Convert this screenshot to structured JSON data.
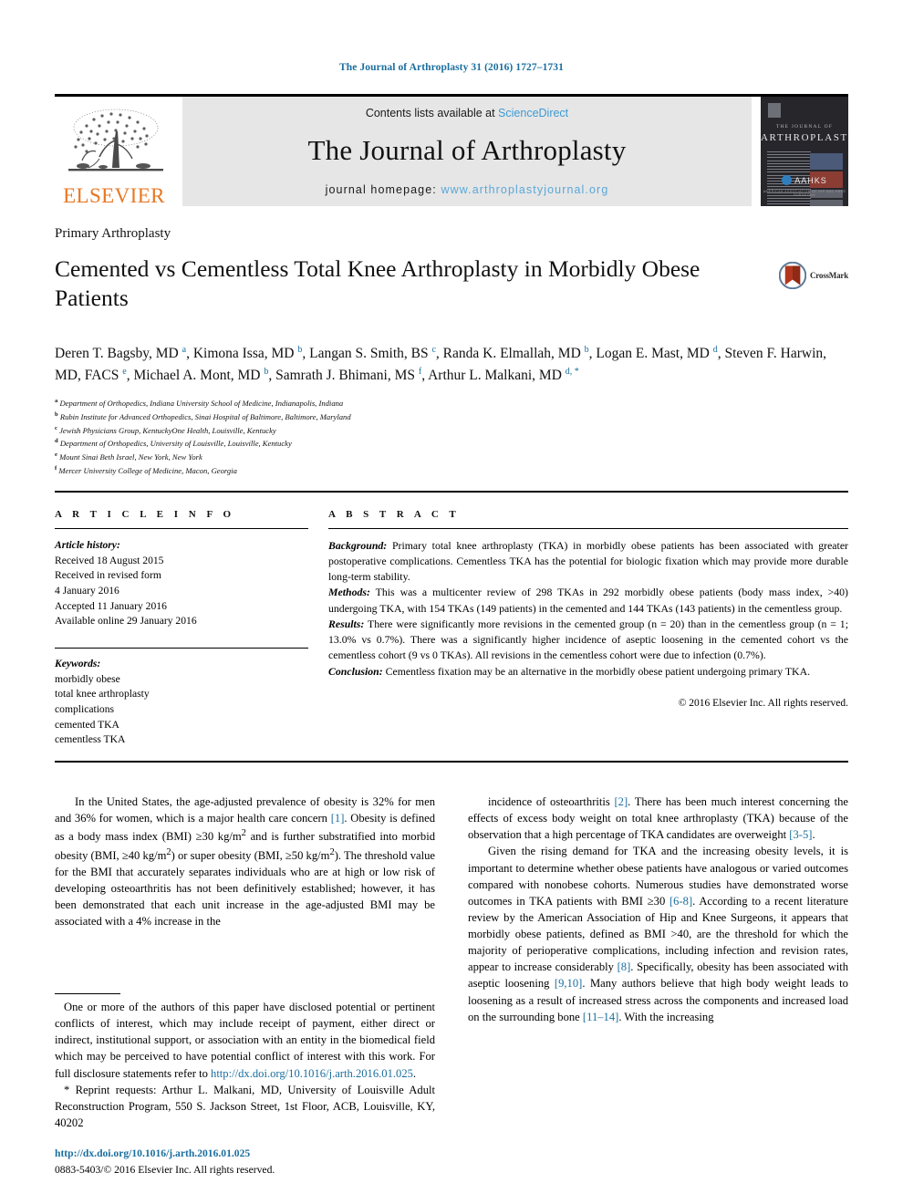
{
  "running_head": "The Journal of Arthroplasty 31 (2016) 1727–1731",
  "masthead": {
    "publisher": "ELSEVIER",
    "contents_prefix": "Contents lists available at ",
    "contents_link": "ScienceDirect",
    "journal_title": "The Journal of Arthroplasty",
    "homepage_prefix": "journal homepage: ",
    "homepage_url": "www.arthroplastyjournal.org",
    "cover": {
      "kicker": "THE JOURNAL OF",
      "name": "ARTHROPLASTY",
      "society": "AAHKS",
      "society_sub": "AMERICAN ASSOCIATION OF HIP AND KNEE SURGEONS"
    }
  },
  "article": {
    "section_kicker": "Primary Arthroplasty",
    "title": "Cemented vs Cementless Total Knee Arthroplasty in Morbidly Obese Patients",
    "crossmark_label": "CrossMark",
    "authors_html": "Deren T. Bagsby, MD <sup>a</sup>, Kimona Issa, MD <sup>b</sup>, Langan S. Smith, BS <sup>c</sup>, Randa K. Elmallah, MD <sup>b</sup>, Logan E. Mast, MD <sup>d</sup>, Steven F. Harwin, MD, FACS <sup>e</sup>, Michael A. Mont, MD <sup>b</sup>, Samrath J. Bhimani, MS <sup>f</sup>, Arthur L. Malkani, MD <sup>d, *</sup>",
    "affiliations": [
      {
        "marker": "a",
        "text": "Department of Orthopedics, Indiana University School of Medicine, Indianapolis, Indiana"
      },
      {
        "marker": "b",
        "text": "Rubin Institute for Advanced Orthopedics, Sinai Hospital of Baltimore, Baltimore, Maryland"
      },
      {
        "marker": "c",
        "text": "Jewish Physicians Group, KentuckyOne Health, Louisville, Kentucky"
      },
      {
        "marker": "d",
        "text": "Department of Orthopedics, University of Louisville, Louisville, Kentucky"
      },
      {
        "marker": "e",
        "text": "Mount Sinai Beth Israel, New York, New York"
      },
      {
        "marker": "f",
        "text": "Mercer University College of Medicine, Macon, Georgia"
      }
    ]
  },
  "article_info": {
    "heading": "A R T I C L E  I N F O",
    "history_label": "Article history:",
    "history_lines": [
      "Received 18 August 2015",
      "Received in revised form",
      "4 January 2016",
      "Accepted 11 January 2016",
      "Available online 29 January 2016"
    ],
    "keywords_label": "Keywords:",
    "keywords": [
      "morbidly obese",
      "total knee arthroplasty",
      "complications",
      "cemented TKA",
      "cementless TKA"
    ]
  },
  "abstract": {
    "heading": "A B S T R A C T",
    "sections": [
      {
        "label": "Background:",
        "text": " Primary total knee arthroplasty (TKA) in morbidly obese patients has been associated with greater postoperative complications. Cementless TKA has the potential for biologic fixation which may provide more durable long-term stability."
      },
      {
        "label": "Methods:",
        "text": " This was a multicenter review of 298 TKAs in 292 morbidly obese patients (body mass index, >40) undergoing TKA, with 154 TKAs (149 patients) in the cemented and 144 TKAs (143 patients) in the cementless group."
      },
      {
        "label": "Results:",
        "text": " There were significantly more revisions in the cemented group (n = 20) than in the cementless group (n = 1; 13.0% vs 0.7%). There was a significantly higher incidence of aseptic loosening in the cemented cohort vs the cementless cohort (9 vs 0 TKAs). All revisions in the cementless cohort were due to infection (0.7%)."
      },
      {
        "label": "Conclusion:",
        "text": " Cementless fixation may be an alternative in the morbidly obese patient undergoing primary TKA."
      }
    ],
    "copyright": "© 2016 Elsevier Inc. All rights reserved."
  },
  "body": {
    "left_paragraph_html": "In the United States, the age-adjusted prevalence of obesity is 32% for men and 36% for women, which is a major health care concern <span class=\"ref\">[1]</span>. Obesity is defined as a body mass index (BMI) ≥30 kg/m<sup>2</sup> and is further substratified into morbid obesity (BMI, ≥40 kg/m<sup>2</sup>) or super obesity (BMI, ≥50 kg/m<sup>2</sup>). The threshold value for the BMI that accurately separates individuals who are at high or low risk of developing osteoarthritis has not been definitively established; however, it has been demonstrated that each unit increase in the age-adjusted BMI may be associated with a 4% increase in the",
    "right_paragraph_1_html": "incidence of osteoarthritis <span class=\"ref\">[2]</span>. There has been much interest concerning the effects of excess body weight on total knee arthroplasty (TKA) because of the observation that a high percentage of TKA candidates are overweight <span class=\"ref\">[3-5]</span>.",
    "right_paragraph_2_html": "Given the rising demand for TKA and the increasing obesity levels, it is important to determine whether obese patients have analogous or varied outcomes compared with nonobese cohorts. Numerous studies have demonstrated worse outcomes in TKA patients with BMI ≥30 <span class=\"ref\">[6-8]</span>. According to a recent literature review by the American Association of Hip and Knee Surgeons, it appears that morbidly obese patients, defined as BMI >40, are the threshold for which the majority of perioperative complications, including infection and revision rates, appear to increase considerably <span class=\"ref\">[8]</span>. Specifically, obesity has been associated with aseptic loosening <span class=\"ref\">[9,10]</span>. Many authors believe that high body weight leads to loosening as a result of increased stress across the components and increased load on the surrounding bone <span class=\"ref\">[11–14]</span>. With the increasing"
  },
  "footnotes": {
    "conflict_html": "One or more of the authors of this paper have disclosed potential or pertinent conflicts of interest, which may include receipt of payment, either direct or indirect, institutional support, or association with an entity in the biomedical field which may be perceived to have potential conflict of interest with this work. For full disclosure statements refer to <a class=\"doi-link\" href=\"#\">http://dx.doi.org/10.1016/j.arth.2016.01.025</a>.",
    "reprint_html": "<span class=\"star\">*</span> Reprint requests: Arthur L. Malkani, MD, University of Louisville Adult Reconstruction Program, 550 S. Jackson Street, 1st Floor, ACB, Louisville, KY, 40202",
    "doi": "http://dx.doi.org/10.1016/j.arth.2016.01.025",
    "issn": "0883-5403/© 2016 Elsevier Inc. All rights reserved."
  },
  "colors": {
    "link_blue": "#1a6e9e",
    "sciencedirect_blue": "#3e9ad4",
    "elsevier_orange": "#e87722",
    "band_gray": "#e6e6e6"
  }
}
